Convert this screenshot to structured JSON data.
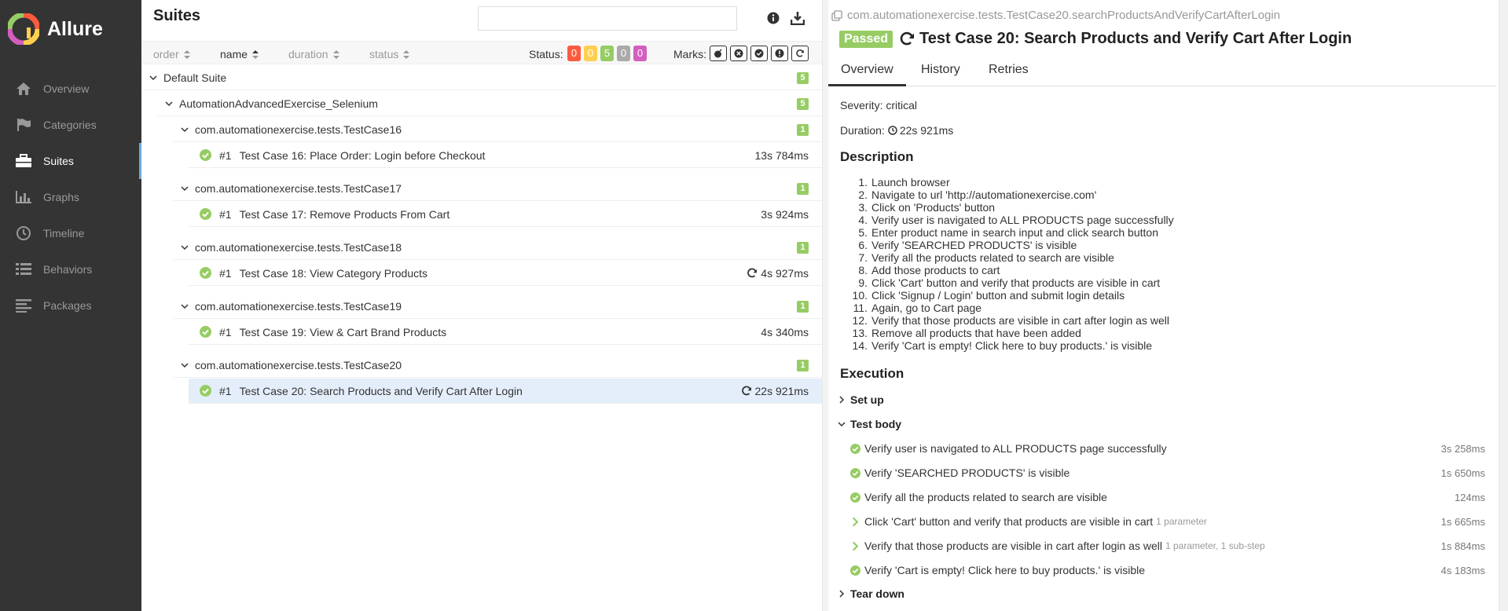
{
  "sidebar": {
    "brand": "Allure",
    "items": [
      {
        "label": "Overview",
        "icon": "home-icon"
      },
      {
        "label": "Categories",
        "icon": "flag-icon"
      },
      {
        "label": "Suites",
        "icon": "briefcase-icon"
      },
      {
        "label": "Graphs",
        "icon": "bar-chart-icon"
      },
      {
        "label": "Timeline",
        "icon": "clock-icon"
      },
      {
        "label": "Behaviors",
        "icon": "list-icon"
      },
      {
        "label": "Packages",
        "icon": "align-left-icon"
      }
    ],
    "active": "Suites"
  },
  "suites": {
    "title": "Suites",
    "search": {
      "value": "",
      "placeholder": ""
    },
    "sort": {
      "order": "order",
      "name": "name",
      "duration": "duration",
      "status": "status"
    },
    "status_label": "Status:",
    "status_counts": [
      {
        "value": "0",
        "color": "#fd5a3e"
      },
      {
        "value": "0",
        "color": "#ffd050"
      },
      {
        "value": "5",
        "color": "#97cc64"
      },
      {
        "value": "0",
        "color": "#aaaaaa"
      },
      {
        "value": "0",
        "color": "#d35ebe"
      }
    ],
    "marks_label": "Marks:",
    "tree": {
      "default_suite": {
        "label": "Default Suite",
        "count": "5"
      },
      "suite": {
        "label": "AutomationAdvancedExercise_Selenium",
        "count": "5"
      },
      "classes": [
        {
          "label": "com.automationexercise.tests.TestCase16",
          "count": "1",
          "test": {
            "num": "#1",
            "name": "Test Case 16: Place Order: Login before Checkout",
            "duration": "13s 784ms",
            "retried": false
          }
        },
        {
          "label": "com.automationexercise.tests.TestCase17",
          "count": "1",
          "test": {
            "num": "#1",
            "name": "Test Case 17: Remove Products From Cart",
            "duration": "3s 924ms",
            "retried": false
          }
        },
        {
          "label": "com.automationexercise.tests.TestCase18",
          "count": "1",
          "test": {
            "num": "#1",
            "name": "Test Case 18: View Category Products",
            "duration": "4s 927ms",
            "retried": true
          }
        },
        {
          "label": "com.automationexercise.tests.TestCase19",
          "count": "1",
          "test": {
            "num": "#1",
            "name": "Test Case 19: View & Cart Brand Products",
            "duration": "4s 340ms",
            "retried": false
          }
        },
        {
          "label": "com.automationexercise.tests.TestCase20",
          "count": "1",
          "test": {
            "num": "#1",
            "name": "Test Case 20: Search Products and Verify Cart After Login",
            "duration": "22s 921ms",
            "retried": true
          }
        }
      ]
    }
  },
  "detail": {
    "crumb": "com.automationexercise.tests.TestCase20.searchProductsAndVerifyCartAfterLogin",
    "status": "Passed",
    "title": "Test Case 20: Search Products and Verify Cart After Login",
    "tabs": [
      "Overview",
      "History",
      "Retries"
    ],
    "severity": "Severity: critical",
    "duration_label": "Duration:",
    "duration": "22s 921ms",
    "description_heading": "Description",
    "description": [
      "Launch browser",
      "Navigate to url 'http://automationexercise.com'",
      "Click on 'Products' button",
      "Verify user is navigated to ALL PRODUCTS page successfully",
      "Enter product name in search input and click search button",
      "Verify 'SEARCHED PRODUCTS' is visible",
      "Verify all the products related to search are visible",
      "Add those products to cart",
      "Click 'Cart' button and verify that products are visible in cart",
      "Click 'Signup / Login' button and submit login details",
      "Again, go to Cart page",
      "Verify that those products are visible in cart after login as well",
      "Remove all products that have been added",
      "Verify 'Cart is empty! Click here to buy products.' is visible"
    ],
    "execution_heading": "Execution",
    "setup": "Set up",
    "body": "Test body",
    "teardown": "Tear down",
    "steps": [
      {
        "name": "Verify user is navigated to ALL PRODUCTS page successfully",
        "note": "",
        "duration": "3s 258ms",
        "expandable": false
      },
      {
        "name": "Verify 'SEARCHED PRODUCTS' is visible",
        "note": "",
        "duration": "1s 650ms",
        "expandable": false
      },
      {
        "name": "Verify all the products related to search are visible",
        "note": "",
        "duration": "124ms",
        "expandable": false
      },
      {
        "name": "Click 'Cart' button and verify that products are visible in cart",
        "note": "1 parameter",
        "duration": "1s 665ms",
        "expandable": true
      },
      {
        "name": "Verify that those products are visible in cart after login as well",
        "note": "1 parameter, 1 sub-step",
        "duration": "1s 884ms",
        "expandable": true
      },
      {
        "name": "Verify 'Cart is empty! Click here to buy products.' is visible",
        "note": "",
        "duration": "4s 183ms",
        "expandable": false
      }
    ]
  }
}
